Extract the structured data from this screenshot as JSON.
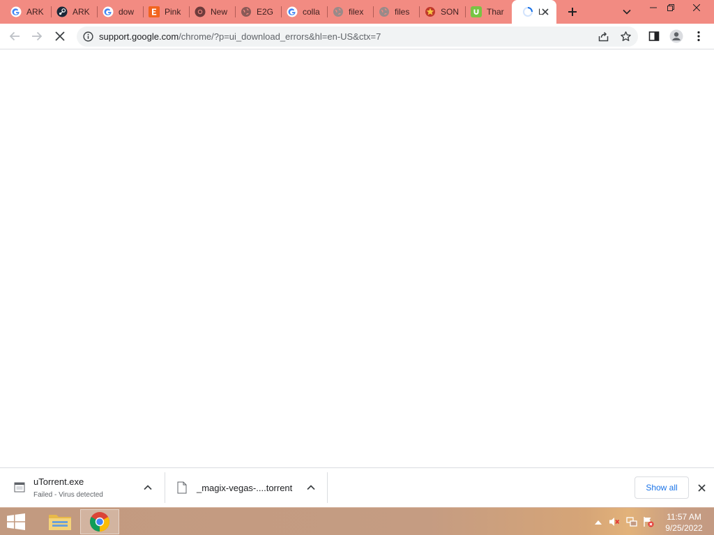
{
  "browser": {
    "tabs": [
      {
        "title": "ARK",
        "icon": "google-icon"
      },
      {
        "title": "ARK",
        "icon": "steam-icon"
      },
      {
        "title": "dow",
        "icon": "google-icon"
      },
      {
        "title": "Pink",
        "icon": "etsy-icon"
      },
      {
        "title": "New",
        "icon": "chrome-icon"
      },
      {
        "title": "E2G",
        "icon": "globe-icon"
      },
      {
        "title": "colla",
        "icon": "google-icon"
      },
      {
        "title": "filex",
        "icon": "globe-icon"
      },
      {
        "title": "files",
        "icon": "globe-icon"
      },
      {
        "title": "SON",
        "icon": "sonic-icon"
      },
      {
        "title": "Thar",
        "icon": "utorrent-icon"
      },
      {
        "title": "L",
        "icon": "loading-spinner-icon",
        "active": true
      }
    ],
    "colors": {
      "tabstrip": "#f28b82",
      "accent": "#1a73e8"
    }
  },
  "toolbar": {
    "url_host": "support.google.com",
    "url_path": "/chrome/?p=ui_download_errors&hl=en-US&ctx=7"
  },
  "downloads": {
    "items": [
      {
        "name": "uTorrent.exe",
        "status": "Failed - Virus detected"
      },
      {
        "name": "_magix-vegas-....torrent",
        "status": ""
      }
    ],
    "show_all_label": "Show all"
  },
  "taskbar": {
    "time": "11:57 AM",
    "date": "9/25/2022"
  }
}
